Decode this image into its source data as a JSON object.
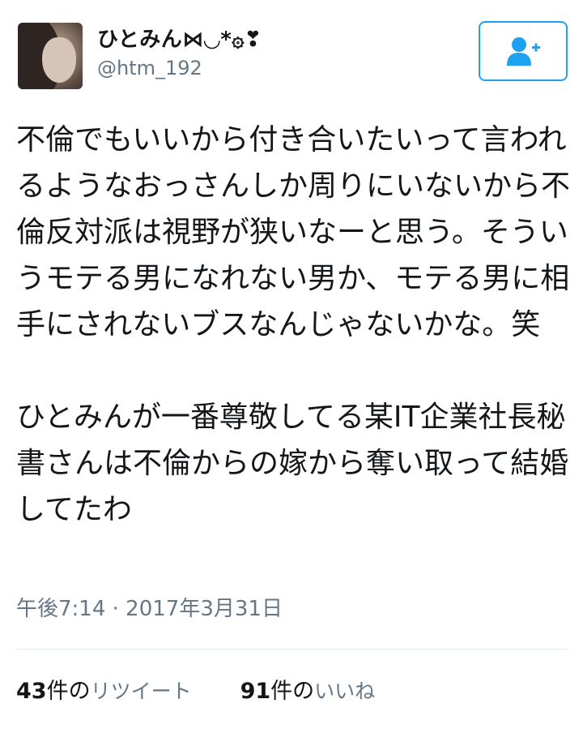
{
  "user": {
    "display_name": "ひとみん⋈◡*۞❣",
    "handle": "@htm_192",
    "avatar_icon": "profile-photo"
  },
  "follow_button": {
    "icon": "add-user-icon",
    "color": "#1da1f2"
  },
  "tweet": {
    "text": "不倫でもいいから付き合いたいって言われるようなおっさんしか周りにいないから不倫反対派は視野が狭いなーと思う。そういうモテる男になれない男か、モテる男に相手にされないブスなんじゃないかな。笑\n\nひとみんが一番尊敬してる某IT企業社長秘書さんは不倫からの嫁から奪い取って結婚してたわ",
    "timestamp": "午後7:14 · 2017年3月31日"
  },
  "stats": {
    "retweets": {
      "count": "43",
      "unit": "件の",
      "label": "リツイート"
    },
    "likes": {
      "count": "91",
      "unit": "件の",
      "label": "いいね"
    }
  },
  "colors": {
    "text": "#14171a",
    "secondary": "#657786",
    "accent": "#1da1f2",
    "divider": "#e1e8ed"
  }
}
